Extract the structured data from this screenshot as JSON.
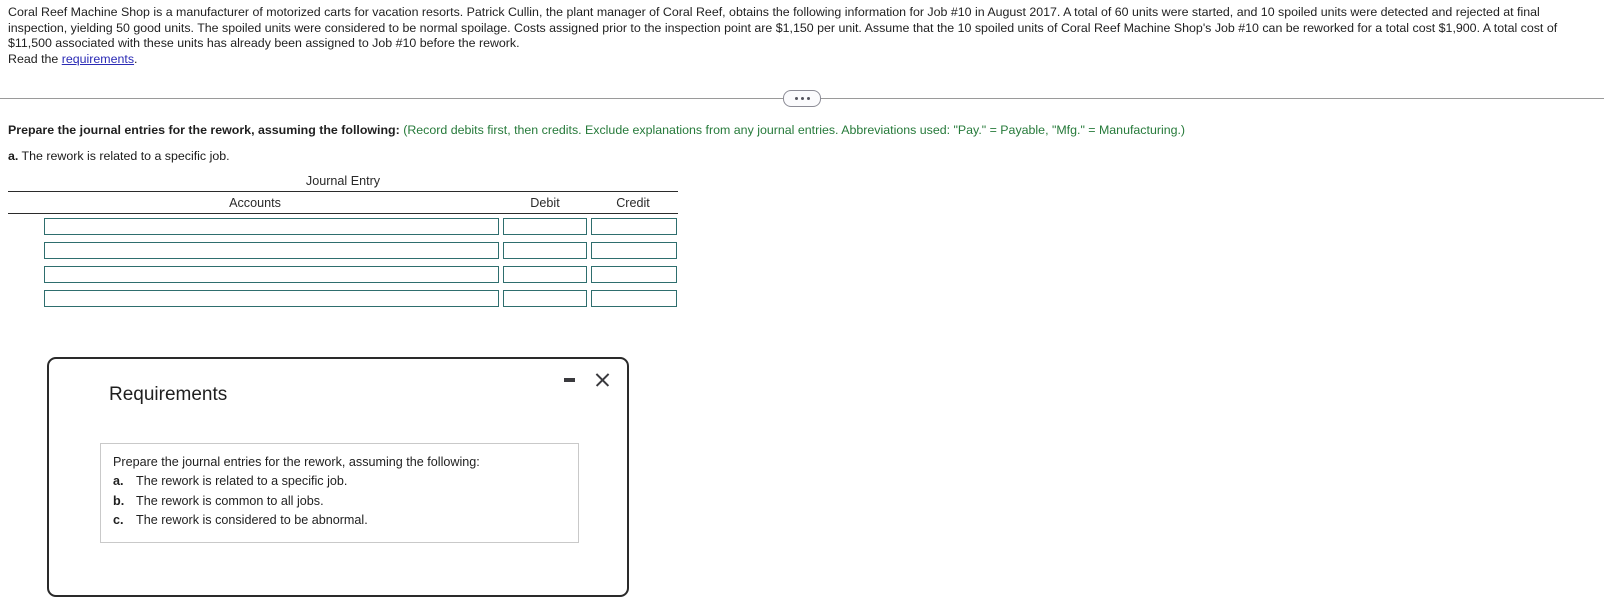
{
  "problem": {
    "paragraph": "Coral Reef Machine Shop is a manufacturer of motorized carts for vacation resorts. Patrick Cullin, the plant manager of Coral Reef, obtains the following information for Job #10 in August 2017. A total of 60 units were started, and 10 spoiled units were detected and rejected at final inspection, yielding 50 good units. The spoiled units were considered to be normal spoilage. Costs assigned prior to the inspection point are $1,150 per unit. Assume that the 10 spoiled units of Coral Reef Machine Shop's Job #10 can be reworked for a total cost $1,900. A total cost of $11,500 associated with these units has already been assigned to Job #10 before the rework.",
    "read_prefix": "Read the ",
    "link_text": "requirements",
    "read_suffix": "."
  },
  "divider": {
    "dots_label": "expand-collapse"
  },
  "instructions": {
    "bold_text": "Prepare the journal entries for the rework, assuming the following:",
    "green_text": "(Record debits first, then credits. Exclude explanations from any journal entries. Abbreviations used: \"Pay.\" = Payable, \"Mfg.\" = Manufacturing.)",
    "sub_letter": "a.",
    "sub_text": " The rework is related to a specific job."
  },
  "journal_entry": {
    "title": "Journal Entry",
    "columns": {
      "accounts": "Accounts",
      "debit": "Debit",
      "credit": "Credit"
    },
    "rows": [
      {
        "accounts": "",
        "debit": "",
        "credit": ""
      },
      {
        "accounts": "",
        "debit": "",
        "credit": ""
      },
      {
        "accounts": "",
        "debit": "",
        "credit": ""
      },
      {
        "accounts": "",
        "debit": "",
        "credit": ""
      }
    ]
  },
  "dialog": {
    "title": "Requirements",
    "minimize_label": "Minimize",
    "close_label": "Close",
    "intro": "Prepare the journal entries for the rework, assuming the following:",
    "items": [
      {
        "bullet": "a.",
        "text": "The rework is related to a specific job."
      },
      {
        "bullet": "b.",
        "text": "The rework is common to all jobs."
      },
      {
        "bullet": "c.",
        "text": "The rework is considered to be abnormal."
      }
    ]
  },
  "colors": {
    "link": "#2b2bb5",
    "green_note": "#267a3a",
    "input_border": "#2e6e6e",
    "dialog_border": "#2a2a2a"
  }
}
